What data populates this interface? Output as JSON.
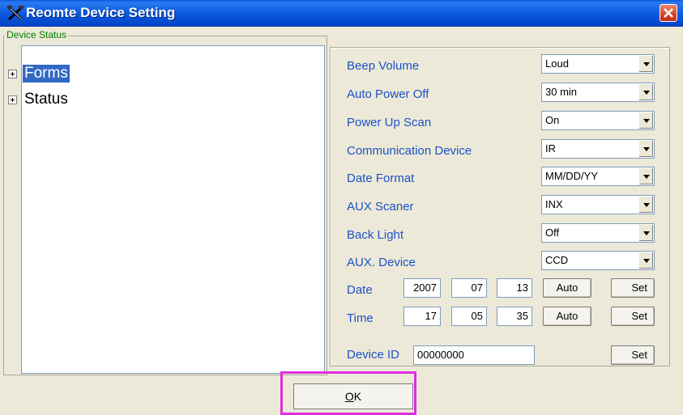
{
  "window": {
    "title": "Reomte Device Setting",
    "icon": "tools-icon",
    "close_icon": "close-icon",
    "accent_color": "#0a58dd",
    "close_color": "#d5452a"
  },
  "left_panel": {
    "group_label": "Device Status",
    "tree": [
      {
        "label": "Forms",
        "selected": true
      },
      {
        "label": "Status",
        "selected": false
      }
    ]
  },
  "settings": {
    "beep_volume": {
      "label": "Beep Volume",
      "value": "Loud"
    },
    "auto_power_off": {
      "label": "Auto Power Off",
      "value": "30 min"
    },
    "power_up_scan": {
      "label": "Power Up Scan",
      "value": "On"
    },
    "communication_device": {
      "label": "Communication Device",
      "value": "IR"
    },
    "date_format": {
      "label": "Date Format",
      "value": "MM/DD/YY"
    },
    "aux_scaner": {
      "label": "AUX Scaner",
      "value": "INX"
    },
    "back_light": {
      "label": "Back Light",
      "value": "Off"
    },
    "aux_device": {
      "label": "AUX. Device",
      "value": "CCD"
    }
  },
  "date": {
    "label": "Date",
    "year": "2007",
    "month": "07",
    "day": "13",
    "auto_label": "Auto",
    "set_label": "Set"
  },
  "time": {
    "label": "Time",
    "hour": "17",
    "minute": "05",
    "second": "35",
    "auto_label": "Auto",
    "set_label": "Set"
  },
  "device_id": {
    "label": "Device ID",
    "value": "00000000",
    "set_label": "Set"
  },
  "footer": {
    "ok_label_hotkey": "O",
    "ok_label_rest": "K",
    "highlight_color": "#e02ee0"
  }
}
